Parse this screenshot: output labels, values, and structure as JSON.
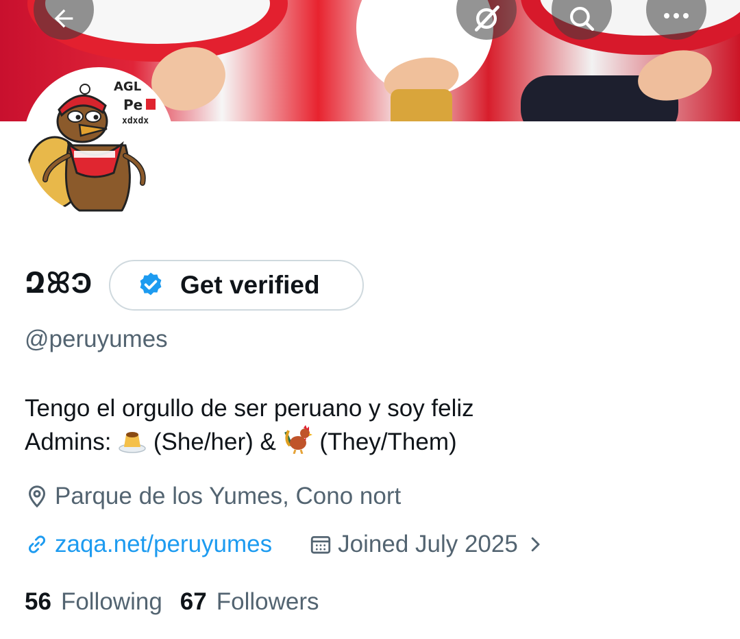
{
  "profile": {
    "display_name": "ԶꕤϿ",
    "handle": "@peruyumes",
    "bio_line1": "Tengo el orgullo de ser peruano y soy feliz",
    "bio_line2_prefix": "Admins:",
    "bio_line2_part1": "(She/her) &",
    "bio_line2_part2": "(They/Them)",
    "location": "Parque de los Yumes, Cono nort",
    "website": "zaqa.net/peruyumes",
    "joined": "Joined July 2025",
    "avatar_text": [
      "AGL",
      "Pe",
      "xdxdx"
    ]
  },
  "verify_button": {
    "label": "Get verified"
  },
  "stats": {
    "following_count": "56",
    "following_label": "Following",
    "followers_count": "67",
    "followers_label": "Followers"
  },
  "colors": {
    "accent": "#1d9bf0",
    "secondary_text": "#536471",
    "primary_text": "#0f1419"
  }
}
